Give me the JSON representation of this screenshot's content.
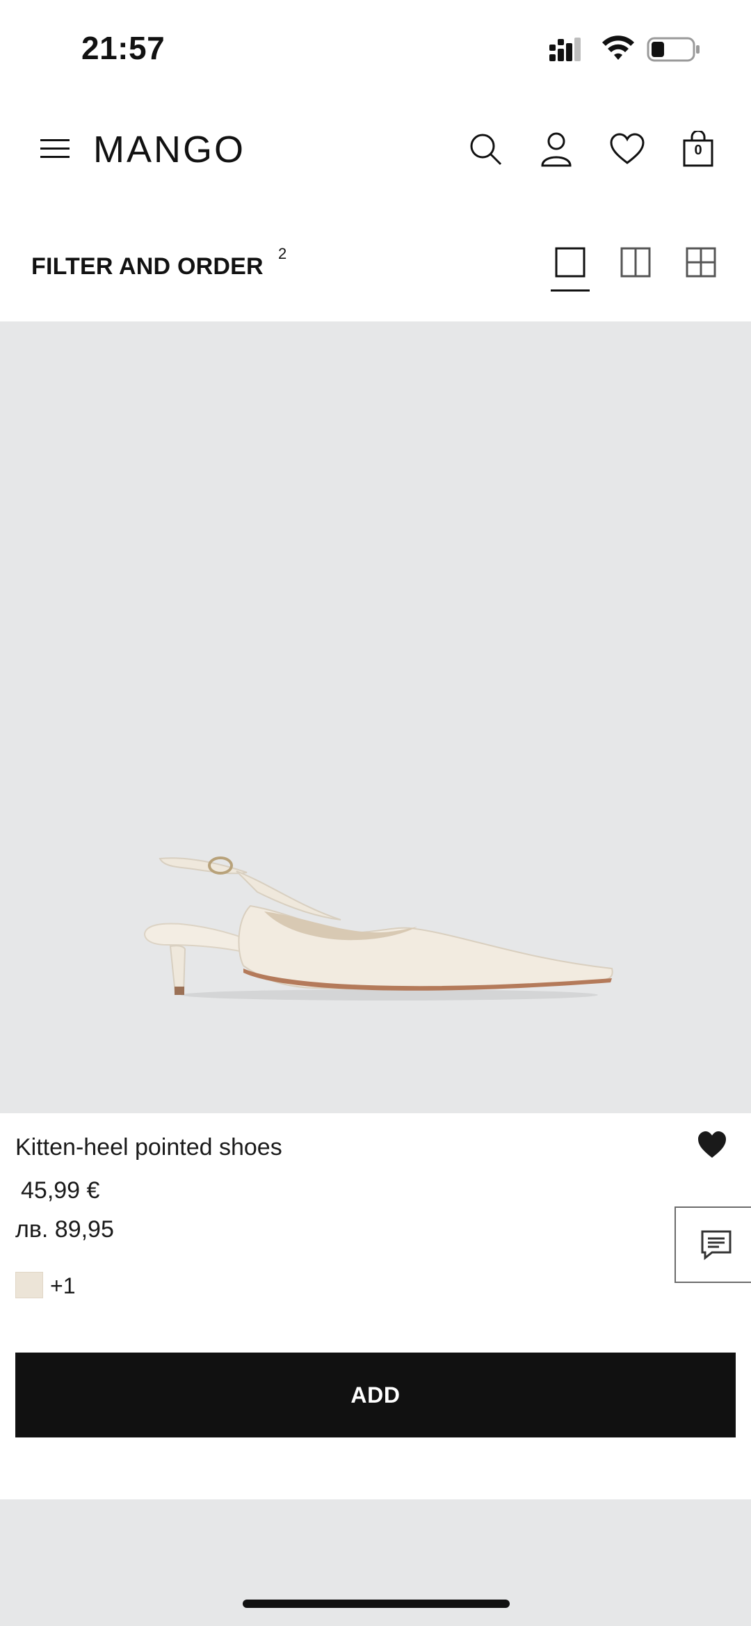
{
  "status_bar": {
    "time": "21:57"
  },
  "header": {
    "logo": "MANGO",
    "cart_count": "0",
    "icons": [
      "menu-icon",
      "search-icon",
      "account-icon",
      "heart-icon",
      "shopping-bag-icon"
    ]
  },
  "filter_bar": {
    "label": "FILTER AND ORDER",
    "count": "2",
    "view_options": [
      "single-column-view",
      "two-column-view",
      "four-grid-view"
    ],
    "active_view": "single-column-view"
  },
  "product": {
    "name": "Kitten-heel pointed shoes",
    "price_eur": "45,99 €",
    "price_bgn": "лв. 89,95",
    "swatch_color": "#ece4d7",
    "more_colors": "+1",
    "add_label": "ADD",
    "wishlisted": true
  },
  "colors": {
    "image_background": "#e6e7e8",
    "button_background": "#111111",
    "button_text": "#ffffff"
  }
}
